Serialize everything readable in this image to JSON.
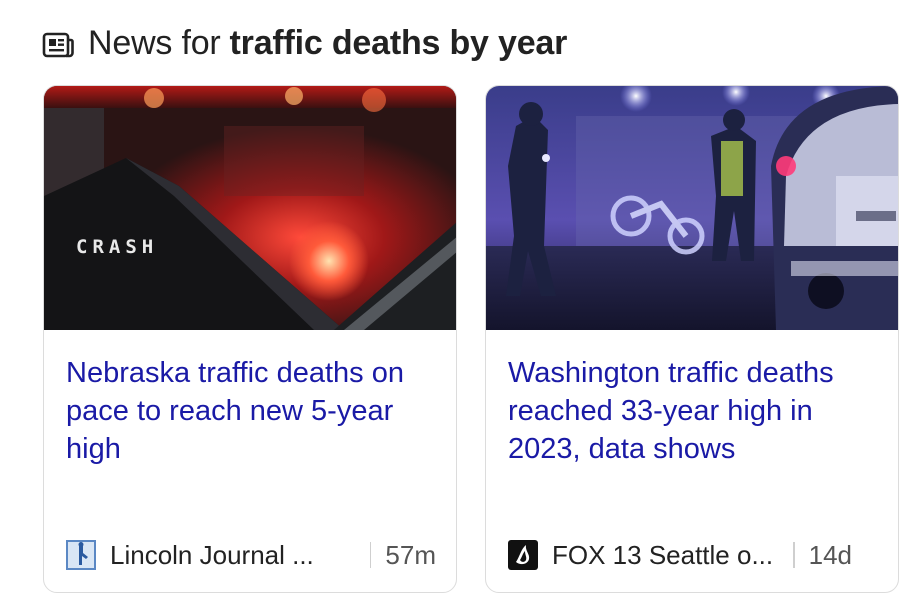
{
  "header": {
    "icon": "newspaper-icon",
    "prefix": "News for",
    "query": "traffic deaths by year"
  },
  "cards": [
    {
      "image_alt_text": "CRASH",
      "title": "Nebraska traffic deaths on pace to reach new 5-year high",
      "source": "Lincoln Journal ...",
      "source_icon": "lincoln-journal-favicon",
      "time": "57m"
    },
    {
      "title": "Washington traffic deaths reached 33-year high in 2023, data shows",
      "source": "FOX 13 Seattle o...",
      "source_icon": "fox13-favicon",
      "time": "14d"
    }
  ],
  "colors": {
    "link": "#1a1aa6",
    "text": "#222222",
    "muted": "#555555",
    "border": "#dcdcdc"
  }
}
